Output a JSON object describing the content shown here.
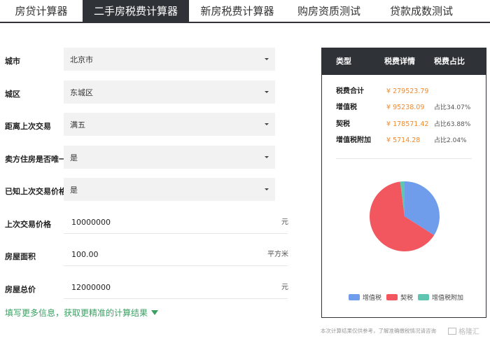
{
  "tabs": [
    {
      "label": "房贷计算器",
      "active": false
    },
    {
      "label": "二手房税费计算器",
      "active": true
    },
    {
      "label": "新房税费计算器",
      "active": false
    },
    {
      "label": "购房资质测试",
      "active": false
    },
    {
      "label": "贷款成数测试",
      "active": false
    }
  ],
  "form": {
    "selects": [
      {
        "label": "城市",
        "value": "北京市"
      },
      {
        "label": "城区",
        "value": "东城区"
      },
      {
        "label": "距离上次交易",
        "value": "满五"
      },
      {
        "label": "卖方住房是否唯一",
        "value": "是"
      },
      {
        "label": "已知上次交易价格",
        "value": "是"
      }
    ],
    "inputs": [
      {
        "label": "上次交易价格",
        "value": "10000000",
        "unit": "元"
      },
      {
        "label": "房屋面积",
        "value": "100.00",
        "unit": "平方米"
      },
      {
        "label": "房屋总价",
        "value": "12000000",
        "unit": "元"
      }
    ],
    "more_link": "填写更多信息，获取更精准的计算结果"
  },
  "result": {
    "headers": [
      "类型",
      "税费详情",
      "税费占比"
    ],
    "rows": [
      {
        "name": "税费合计",
        "amount": "¥ 279523.79",
        "ratio": ""
      },
      {
        "name": "增值税",
        "amount": "¥ 95238.09",
        "ratio": "占比34.07%"
      },
      {
        "name": "契税",
        "amount": "¥ 178571.42",
        "ratio": "占比63.88%"
      },
      {
        "name": "增值税附加",
        "amount": "¥ 5714.28",
        "ratio": "占比2.04%"
      }
    ],
    "pie": [
      {
        "name": "增值税",
        "value": 34.07,
        "color": "#6f9ceb"
      },
      {
        "name": "契税",
        "value": 63.88,
        "color": "#f2575f"
      },
      {
        "name": "增值税附加",
        "value": 2.04,
        "color": "#5ec5b0"
      }
    ],
    "legend": [
      "增值税",
      "契税",
      "增值税附加"
    ]
  },
  "footnote": "本次计算结果仅供参考，了解准确缴税情况请咨询",
  "watermark": "格隆汇"
}
